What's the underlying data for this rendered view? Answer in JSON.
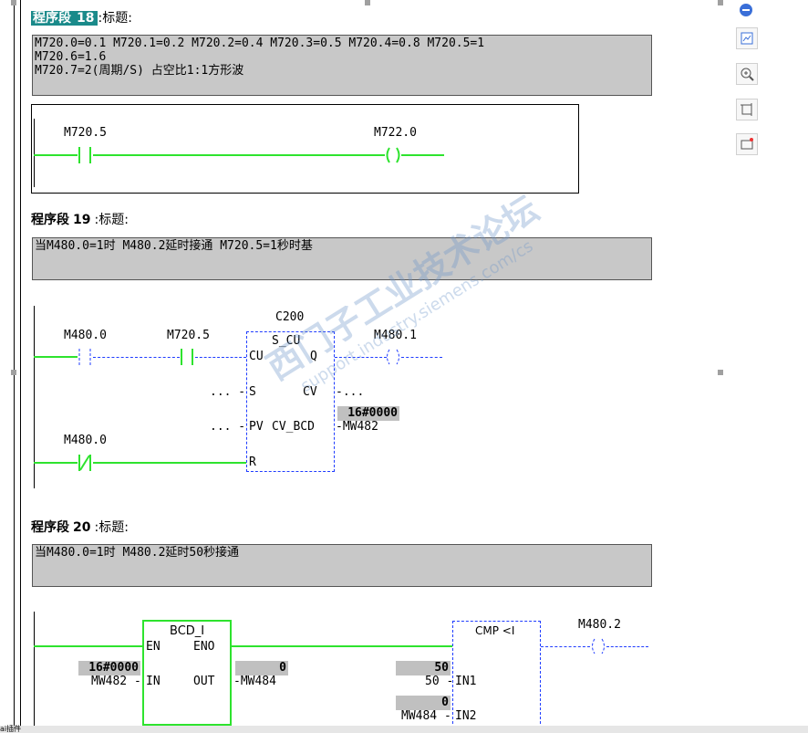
{
  "networks": [
    {
      "label": "程序段",
      "number": "18",
      "title_sep": ":",
      "title": "标题:",
      "comment_lines": [
        "M720.0=0.1  M720.1=0.2  M720.2=0.4  M720.3=0.5  M720.4=0.8  M720.5=1",
        "M720.6=1.6",
        "M720.7=2(周期/S) 占空比1:1方形波"
      ],
      "contact": "M720.5",
      "coil": "M722.0"
    },
    {
      "label": "程序段",
      "number": "19",
      "title_sep": ":",
      "title": "标题:",
      "comment_lines": [
        "当M480.0=1时 M480.2延时接通 M720.5=1秒时基"
      ],
      "contact1": "M480.0",
      "contact2": "M720.5",
      "counter_name": "C200",
      "counter_type": "S_CU",
      "pin_cu": "CU",
      "pin_q": "Q",
      "pin_s": "S",
      "pin_cv": "CV",
      "pin_pv": "PV",
      "pin_cvbcd": "CV_BCD",
      "pin_r": "R",
      "dots": "...",
      "cv_out": "-...",
      "pv_in": "... -",
      "s_in": "... -",
      "cv_value": "16#0000",
      "cvbcd_out": "-MW482",
      "coil": "M480.1",
      "reset_contact": "M480.0"
    },
    {
      "label": "程序段",
      "number": "20",
      "title_sep": ":",
      "title": "标题:",
      "comment_lines": [
        "当M480.0=1时 M480.2延时50秒接通"
      ],
      "bcd_name": "BCD_I",
      "pin_en": "EN",
      "pin_eno": "ENO",
      "pin_in": "IN",
      "pin_out": "OUT",
      "in_value": "16#0000",
      "in_operand": "MW482 -",
      "out_value": "0",
      "out_operand": "-MW484",
      "cmp_name": "CMP <I",
      "in1_value": "50",
      "in1_operand": "50 -",
      "pin_in1": "IN1",
      "in2_value": "0",
      "in2_operand": "MW484 -",
      "pin_in2": "IN2",
      "coil": "M480.2"
    }
  ],
  "watermark": {
    "line1": "西门子工业技术论坛",
    "line2": "support.industry.siemens.com/cs"
  },
  "toolbar": {
    "collapse_icon": "minus-circle-icon",
    "buttons": [
      "chart-icon",
      "zoom-in-icon",
      "crop-icon",
      "screenshot-icon"
    ]
  },
  "statusbar": {
    "text": "ai插件"
  },
  "colors": {
    "rung": "#2ee32e",
    "dashed": "#1f3cff",
    "title_bg": "#1a8a8a",
    "comment_bg": "#c8c8c8"
  }
}
